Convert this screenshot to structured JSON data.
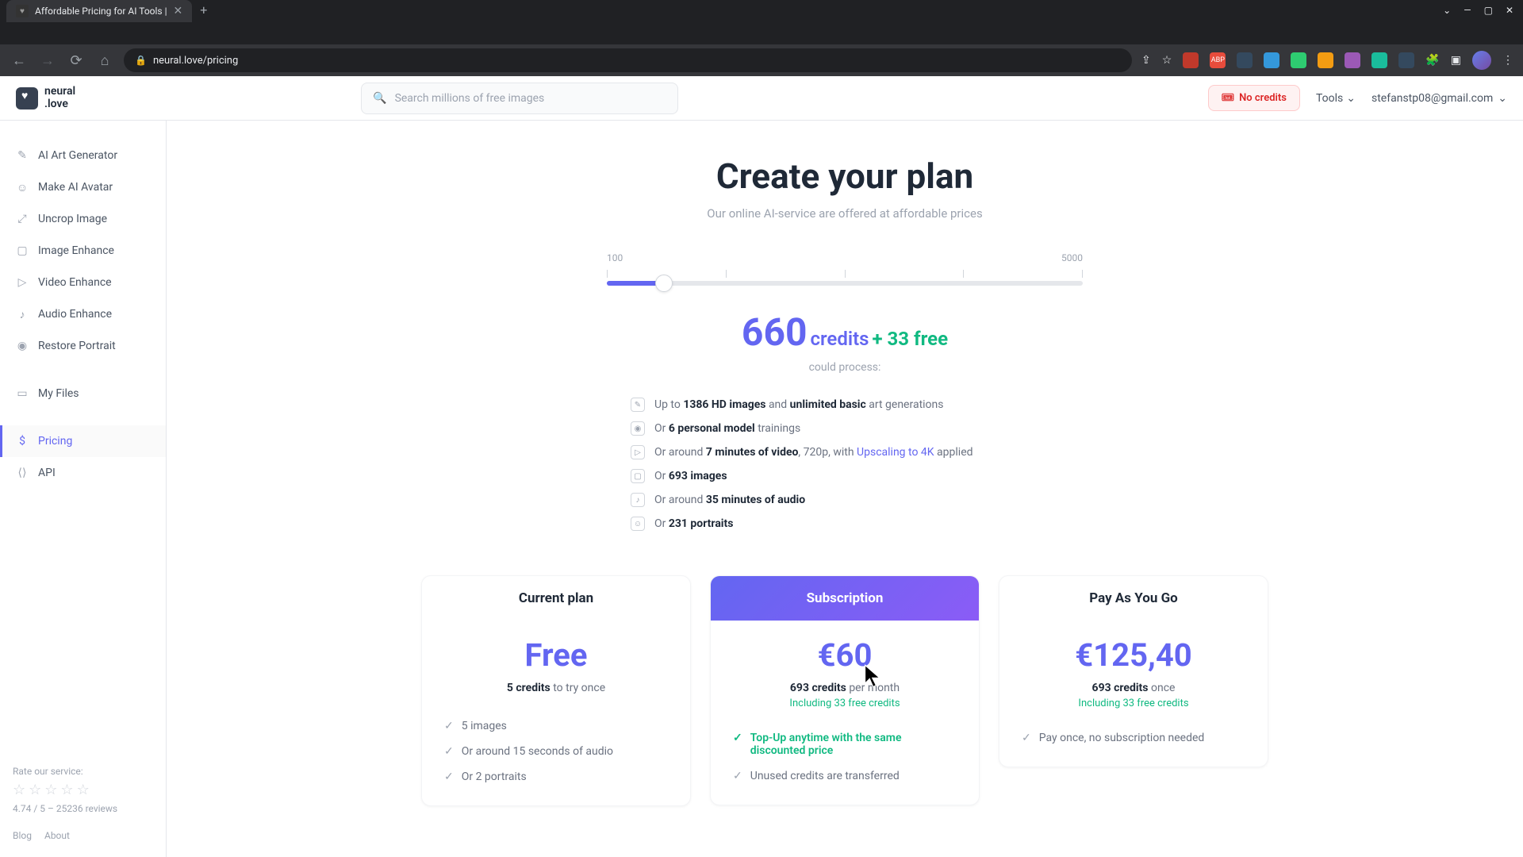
{
  "browser": {
    "tab_title": "Affordable Pricing for AI Tools |",
    "url": "neural.love/pricing"
  },
  "header": {
    "logo_line1": "neural",
    "logo_line2": ".love",
    "search_placeholder": "Search millions of free images",
    "no_credits": "No credits",
    "tools": "Tools",
    "user_email": "stefanstp08@gmail.com"
  },
  "sidebar": {
    "items": [
      {
        "label": "AI Art Generator",
        "icon": "✎"
      },
      {
        "label": "Make AI Avatar",
        "icon": "☺"
      },
      {
        "label": "Uncrop Image",
        "icon": "⤢"
      },
      {
        "label": "Image Enhance",
        "icon": "▢"
      },
      {
        "label": "Video Enhance",
        "icon": "▷"
      },
      {
        "label": "Audio Enhance",
        "icon": "♪"
      },
      {
        "label": "Restore Portrait",
        "icon": "◉"
      }
    ],
    "my_files": "My Files",
    "pricing": "Pricing",
    "api": "API",
    "rate_label": "Rate our service:",
    "rating_text": "4.74 / 5 – 25236 reviews",
    "blog": "Blog",
    "about": "About"
  },
  "main": {
    "title": "Create your plan",
    "subtitle": "Our online AI-service are offered at affordable prices",
    "slider_min": "100",
    "slider_max": "5000",
    "credits_num": "660",
    "credits_label": "credits",
    "credits_free": "+ 33 free",
    "could_process": "could process:",
    "process": [
      {
        "text_pre": "Up to ",
        "bold1": "1386 HD images",
        "text_mid": " and ",
        "bold2": "unlimited basic",
        "text_post": " art generations"
      },
      {
        "text_pre": "Or ",
        "bold1": "6 personal model",
        "text_post": " trainings"
      },
      {
        "text_pre": "Or around ",
        "bold1": "7 minutes of video",
        "text_mid": ", 720p, with ",
        "link": "Upscaling to 4K",
        "text_post": " applied"
      },
      {
        "text_pre": "Or ",
        "bold1": "693 images"
      },
      {
        "text_pre": "Or around ",
        "bold1": "35 minutes of audio"
      },
      {
        "text_pre": "Or ",
        "bold1": "231 portraits"
      }
    ],
    "plans": {
      "free": {
        "header": "Current plan",
        "price": "Free",
        "credits_bold": "5 credits",
        "credits_text": " to try once",
        "features": [
          "5 images",
          "Or around 15 seconds of audio",
          "Or 2 portraits"
        ]
      },
      "subscription": {
        "header": "Subscription",
        "price": "€60",
        "credits_bold": "693 credits",
        "credits_text": " per month",
        "including": "Including 33 free credits",
        "feature_highlight": "Top-Up anytime with the same discounted price",
        "feature2": "Unused credits are transferred"
      },
      "payg": {
        "header": "Pay As You Go",
        "price": "€125,40",
        "credits_bold": "693 credits",
        "credits_text": " once",
        "including": "Including 33 free credits",
        "feature1": "Pay once, no subscription needed"
      }
    }
  }
}
